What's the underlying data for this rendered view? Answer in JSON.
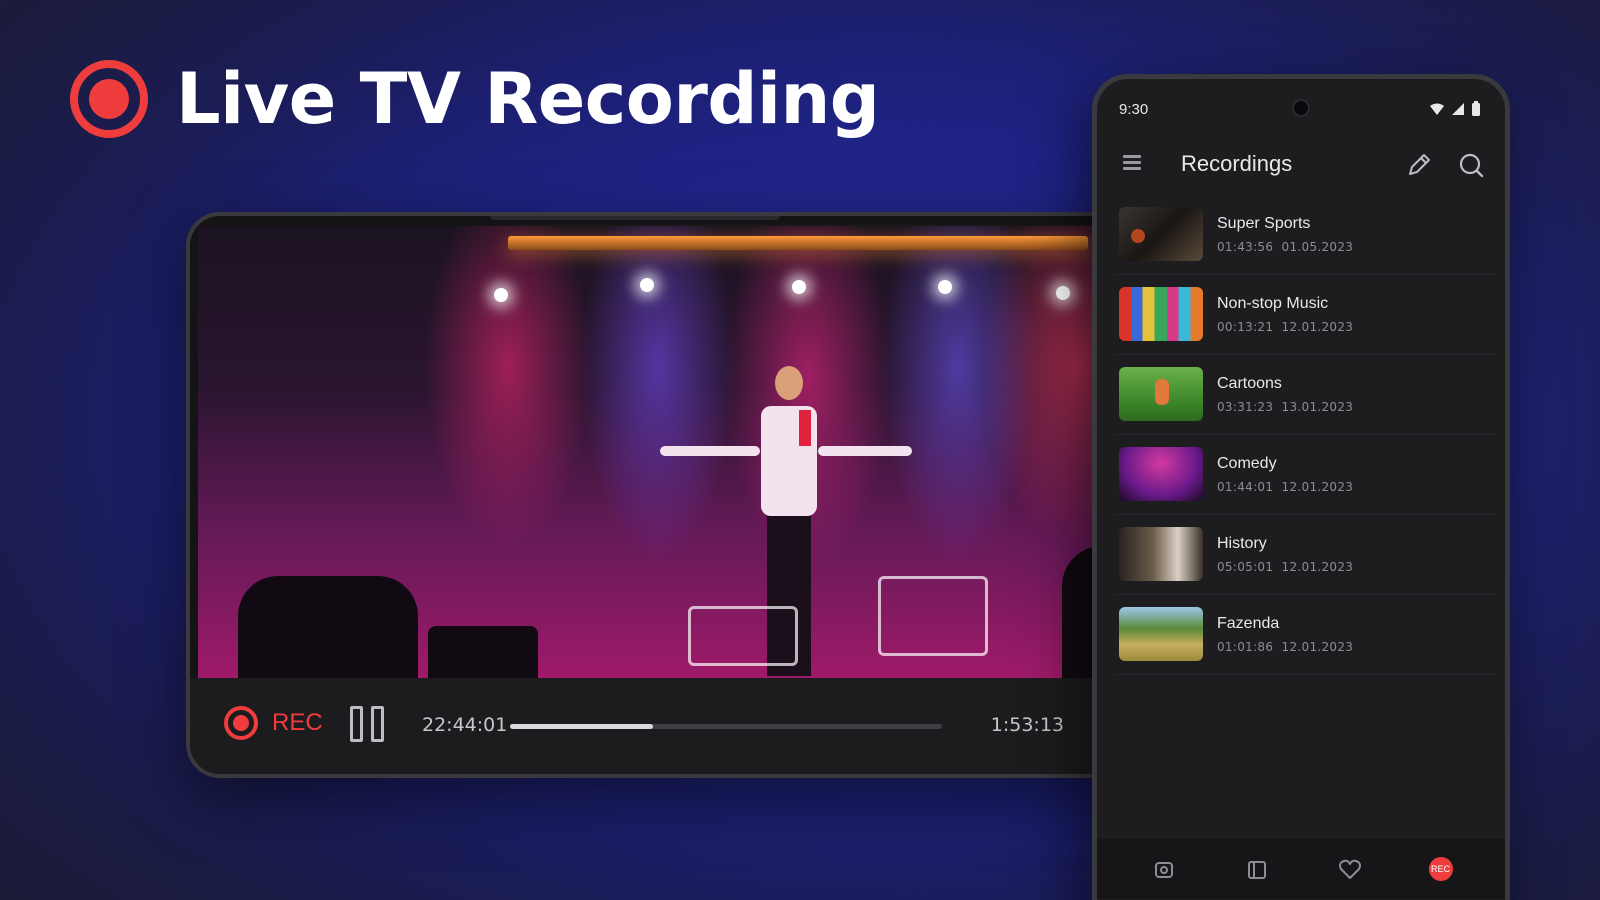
{
  "headline": {
    "title": "Live TV Recording",
    "accent_color": "#ef3d3d",
    "icon": "record-icon"
  },
  "player": {
    "rec_label": "REC",
    "current_time": "22:44:01",
    "total_time": "1:53:13",
    "progress": 0.33,
    "icons": [
      "record-icon",
      "pause-icon",
      "volume-icon"
    ]
  },
  "phone": {
    "status_time": "9:30",
    "app_title": "Recordings",
    "recordings": [
      {
        "title": "Super Sports",
        "duration": "01:43:56",
        "date": "01.05.2023",
        "thumb": "sports"
      },
      {
        "title": "Non-stop Music",
        "duration": "00:13:21",
        "date": "12.01.2023",
        "thumb": "music"
      },
      {
        "title": "Cartoons",
        "duration": "03:31:23",
        "date": "13.01.2023",
        "thumb": "cartoon"
      },
      {
        "title": "Comedy",
        "duration": "01:44:01",
        "date": "12.01.2023",
        "thumb": "comedy"
      },
      {
        "title": "History",
        "duration": "05:05:01",
        "date": "12.01.2023",
        "thumb": "history"
      },
      {
        "title": "Fazenda",
        "duration": "01:01:86",
        "date": "12.01.2023",
        "thumb": "farm"
      }
    ],
    "nav": [
      "home-icon",
      "guide-icon",
      "favorites-icon",
      "rec-icon"
    ],
    "nav_rec_label": "REC"
  }
}
